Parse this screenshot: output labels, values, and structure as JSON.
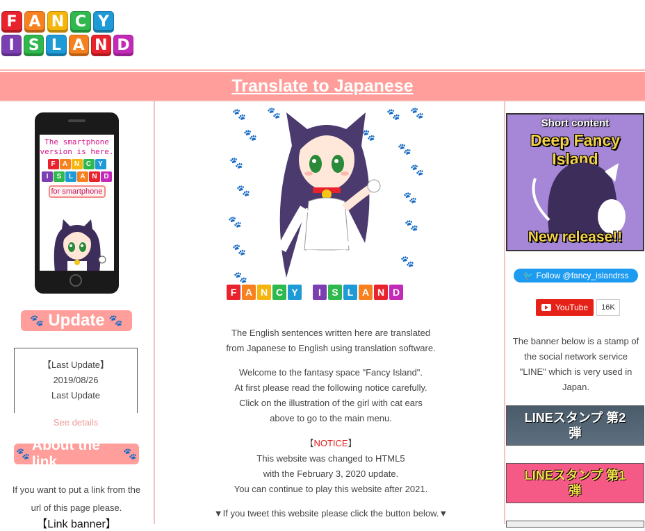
{
  "logo": {
    "row1": [
      {
        "ch": "F",
        "color": "#e8232d"
      },
      {
        "ch": "A",
        "color": "#f7811f"
      },
      {
        "ch": "N",
        "color": "#f5b50d"
      },
      {
        "ch": "C",
        "color": "#2fb84d"
      },
      {
        "ch": "Y",
        "color": "#1e9ad6"
      }
    ],
    "row2": [
      {
        "ch": "I",
        "color": "#7b3fb2"
      },
      {
        "ch": "S",
        "color": "#2fb84d"
      },
      {
        "ch": "L",
        "color": "#1e9ad6"
      },
      {
        "ch": "A",
        "color": "#f7811f"
      },
      {
        "ch": "N",
        "color": "#e8232d"
      },
      {
        "ch": "D",
        "color": "#c42ab8"
      }
    ]
  },
  "translate": {
    "label": "Translate to Japanese"
  },
  "phone": {
    "line1": "The smartphone",
    "line2": "version is here.",
    "button": "for smartphone"
  },
  "update": {
    "title": "Update",
    "box_line1": "【Last Update】",
    "box_line2": "2019/08/26",
    "box_line3": "Last Update",
    "see_details": "See details"
  },
  "about": {
    "title": "About the link",
    "text1": "If you want to put a link from the",
    "text2": "url of this page please.",
    "banner": "【Link banner】"
  },
  "hero": {
    "logo_text": [
      "F",
      "A",
      "N",
      "C",
      "Y",
      "I",
      "S",
      "L",
      "A",
      "N",
      "D"
    ]
  },
  "center": {
    "p1_l1": "The English sentences written here are translated",
    "p1_l2": "from Japanese to English using translation software.",
    "p2_l1": "Welcome to the fantasy space \"Fancy Island\".",
    "p2_l2": "At first please read the following notice carefully.",
    "p2_l3": "Click on the illustration of the girl with cat ears",
    "p2_l4": "above to go to the main menu.",
    "notice_open": "【",
    "notice": "NOTICE",
    "notice_close": "】",
    "p3_l1": "This website was changed to HTML5",
    "p3_l2": "with the February 3, 2020 update.",
    "p3_l3": "You can continue to play this website after 2021.",
    "tweet": "▼If you tweet this website please click the button below.▼"
  },
  "right": {
    "deep_line1": "Short content",
    "deep_line2": "Deep Fancy Island",
    "deep_line3": "New release!!",
    "twitter": "Follow @fancy_islandrss",
    "youtube": "YouTube",
    "youtube_count": "16K",
    "line_l1": "The banner below is a stamp of",
    "line_l2": "the social network service",
    "line_l3": "\"LINE\" which is very used in",
    "line_l4": "Japan.",
    "stamp2": "LINEスタンプ 第2弾",
    "stamp1": "LINEスタンプ 第1弾"
  },
  "colors": {
    "accent": "#ff9e9a",
    "notice": "#e21c1c",
    "twitter": "#1d9bf0",
    "youtube": "#e62117"
  }
}
